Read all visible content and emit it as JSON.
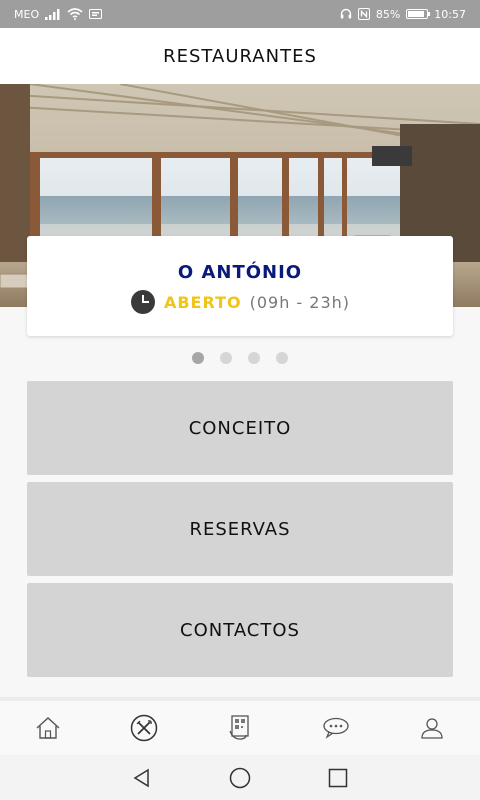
{
  "status_bar": {
    "carrier": "MEO",
    "battery": "85%",
    "battery_level": 0.85,
    "time": "10:57"
  },
  "header": {
    "title": "RESTAURANTES"
  },
  "restaurant": {
    "name": "O ANTÓNIO",
    "status": "ABERTO",
    "hours": "(09h - 23h)"
  },
  "carousel": {
    "count": 4,
    "active_index": 0
  },
  "menu": {
    "items": [
      {
        "label": "CONCEITO"
      },
      {
        "label": "RESERVAS"
      },
      {
        "label": "CONTACTOS"
      }
    ]
  },
  "tabs": [
    {
      "icon": "home-icon"
    },
    {
      "icon": "fork-knife-icon"
    },
    {
      "icon": "qr-menu-icon"
    },
    {
      "icon": "chat-icon"
    },
    {
      "icon": "user-icon"
    }
  ],
  "colors": {
    "restaurant_name": "#0a1a7a",
    "open_status": "#f0c419",
    "button_bg": "#d4d4d4",
    "statusbar_bg": "#9e9e9e"
  }
}
